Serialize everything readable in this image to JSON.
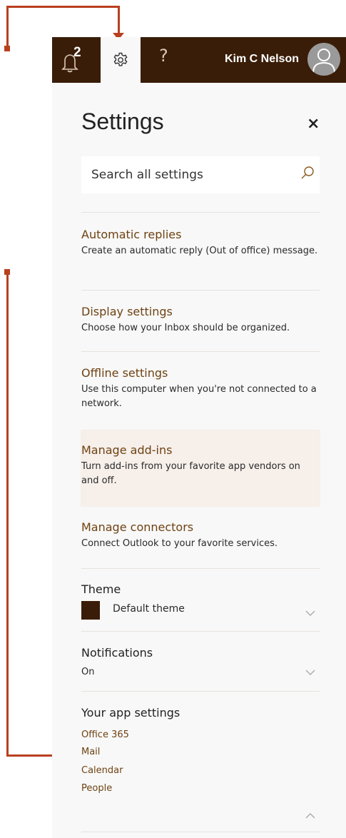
{
  "header": {
    "notification_count": "2",
    "user_name": "Kim C Nelson",
    "help_glyph": "?"
  },
  "settings": {
    "title": "Settings",
    "close_glyph": "×",
    "search_placeholder": "Search all settings",
    "items": [
      {
        "title": "Automatic replies",
        "desc": "Create an automatic reply (Out of office) message."
      },
      {
        "title": "Display settings",
        "desc": "Choose how your Inbox should be organized."
      },
      {
        "title": "Offline settings",
        "desc": "Use this computer when you're not connected to a network."
      },
      {
        "title": "Manage add-ins",
        "desc": "Turn add-ins from your favorite app vendors on and off."
      },
      {
        "title": "Manage connectors",
        "desc": "Connect Outlook to your favorite services."
      }
    ],
    "theme": {
      "label": "Theme",
      "value": "Default theme",
      "swatch_color": "#3a1d08"
    },
    "notifications": {
      "label": "Notifications",
      "value": "On"
    },
    "app_settings": {
      "label": "Your app settings",
      "links": [
        "Office 365",
        "Mail",
        "Calendar",
        "People"
      ]
    }
  },
  "colors": {
    "header_bg": "#3a1d08",
    "link": "#6e4212",
    "annotation": "#b8401f",
    "highlight_bg": "#f6efea"
  },
  "icons": [
    "bell-icon",
    "gear-icon",
    "help-icon",
    "avatar-icon",
    "search-icon",
    "close-icon",
    "chevron-down-icon",
    "chevron-up-icon"
  ]
}
